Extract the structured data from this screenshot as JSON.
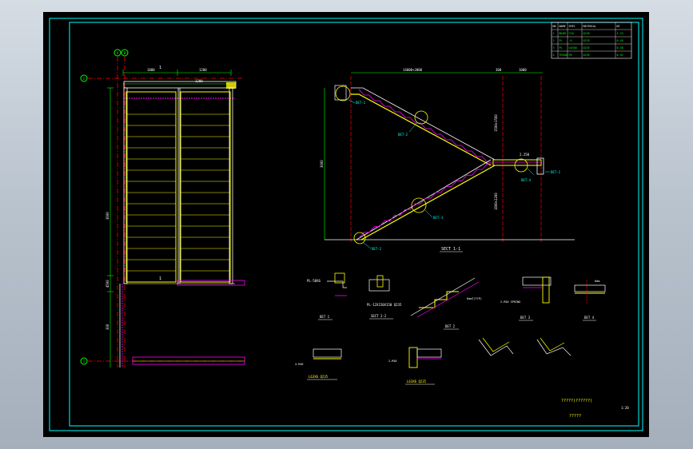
{
  "colors": {
    "background": "#000000",
    "frame": "#00ffff",
    "steel": "#ffff00",
    "centerline": "#ff0000",
    "bolt": "#ff00ff",
    "dimension": "#00ff00",
    "text": "#ffffff"
  },
  "grid_labels": {
    "col_a": "A",
    "col_b": "B",
    "row_1": "1",
    "row_2": "2"
  },
  "plan": {
    "dims_top": [
      "1800",
      "1200"
    ],
    "dim_total_span": "1200",
    "dims_left": [
      "3600",
      "4500",
      "300"
    ],
    "line_label": "1",
    "section_mark": "1"
  },
  "section_view": {
    "dim_top": "14000+2000",
    "dims_top_right": [
      "300",
      "1000"
    ],
    "dim_height": "3000",
    "dim_flight_upper": "1500+1500",
    "dim_flight_lower": "1800+2200",
    "landing_level": "2.250",
    "details": [
      "DET-1",
      "DET-2",
      "DET-3",
      "DET-4",
      "DET-1",
      "DET-2"
    ],
    "caption": "SECT 1-1"
  },
  "details": {
    "det1": {
      "caption": "DET 1",
      "note": "PL-50X6"
    },
    "sect22": {
      "caption": "SECT 2-2",
      "note": "PL-12X150X150 Q235"
    },
    "det2": {
      "caption": "DET 2",
      "note": "6mmT(TYP)"
    },
    "det3": {
      "caption": "DET 3",
      "note": "2-M16 SPRING"
    },
    "det4": {
      "caption": "DET 4",
      "note": "6mm"
    },
    "bolt_a": {
      "caption": "L63X6 Q235",
      "note": "4-M16"
    },
    "bolt_b": {
      "caption": "L63X6 Q235",
      "note": "2-M16"
    }
  },
  "material_table": {
    "header": [
      "NO",
      "NAME",
      "SPEC",
      "MATERIAL",
      "WT"
    ],
    "rows": [
      [
        "1",
        "BEAM",
        "C20",
        "Q235",
        "1.23"
      ],
      [
        "2",
        "PL",
        "-6",
        "Q235",
        "0.45"
      ],
      [
        "3",
        "PL",
        "L63X6",
        "Q235",
        "0.38"
      ],
      [
        "4",
        "TREAD",
        "FB",
        "Q235",
        "0.92"
      ]
    ]
  },
  "title_block": {
    "title": "?????(??????)",
    "subtitle": "?????",
    "scale": "1:20"
  }
}
